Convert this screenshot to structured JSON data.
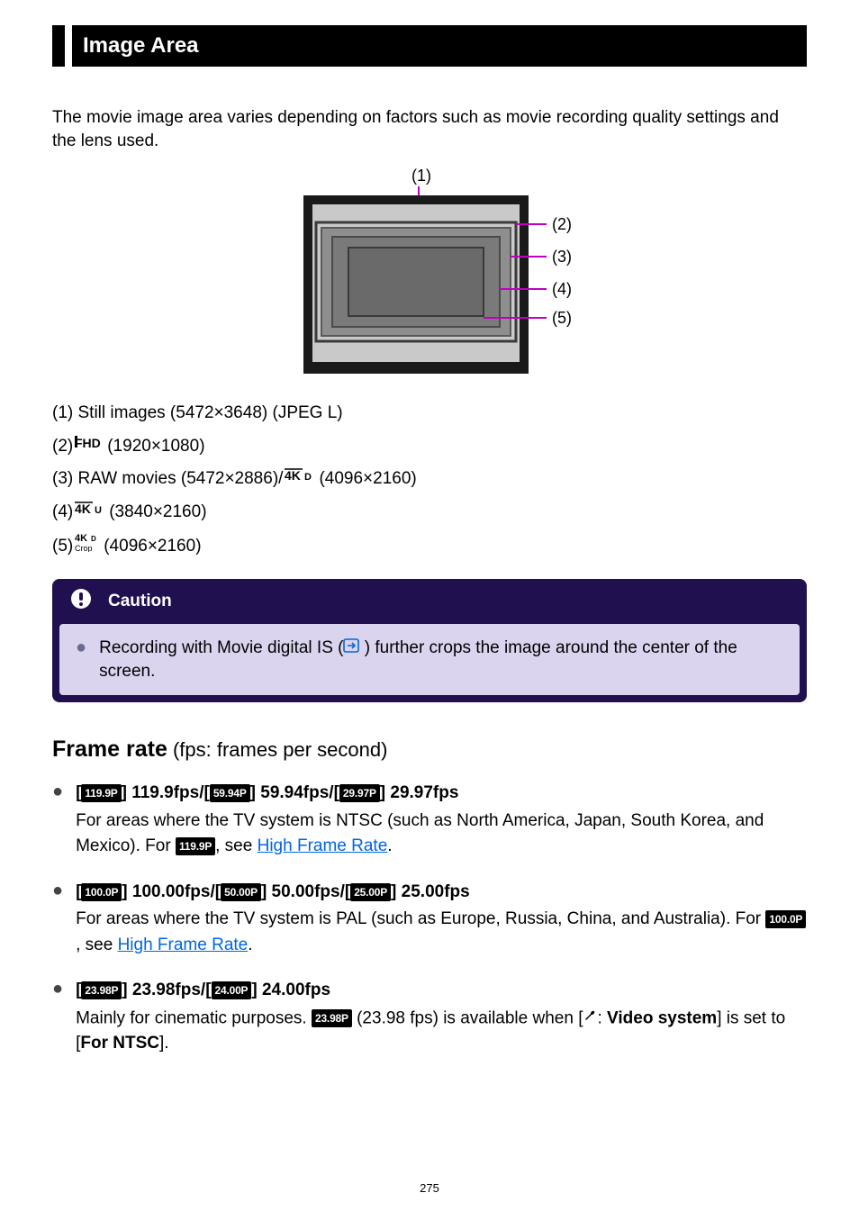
{
  "heading": "Image Area",
  "intro": "The movie image area varies depending on factors such as movie recording quality settings and the lens used.",
  "diagram": {
    "top_label": "(1)",
    "right_labels": [
      "(2)",
      "(3)",
      "(4)",
      "(5)"
    ]
  },
  "resolutions": {
    "r1_pre": "(1) Still images (5472×3648) (JPEG L)",
    "r2_pre": "(2) ",
    "r2_post": " (1920×1080)",
    "r3_pre": "(3) RAW movies (5472×2886)/",
    "r3_post": " (4096×2160)",
    "r4_pre": "(4) ",
    "r4_post": " (3840×2160)",
    "r5_pre": "(5) ",
    "r5_post": " (4096×2160)"
  },
  "caution": {
    "title": "Caution",
    "text_pre": "Recording with Movie digital IS (",
    "text_post": " ) further crops the image around the center of the screen."
  },
  "frame_rate": {
    "title": "Frame rate",
    "subtitle": " (fps: frames per second)",
    "items": [
      {
        "line1_parts": [
          "[",
          "] 119.9fps/[",
          "] 59.94fps/[",
          "] 29.97fps"
        ],
        "badges1": [
          "119.9P",
          "59.94P",
          "29.97P"
        ],
        "body_pre": "For areas where the TV system is NTSC (such as North America, Japan, South Korea, and Mexico). For ",
        "body_badge": "119.9P",
        "body_mid": ", see ",
        "link": "High Frame Rate",
        "body_post": "."
      },
      {
        "line1_parts": [
          "[",
          "] 100.00fps/[",
          "] 50.00fps/[",
          "] 25.00fps"
        ],
        "badges1": [
          "100.0P",
          "50.00P",
          "25.00P"
        ],
        "body_pre": "For areas where the TV system is PAL (such as Europe, Russia, China, and Australia). For ",
        "body_badge": "100.0P",
        "body_mid": ", see ",
        "link": "High Frame Rate",
        "body_post": "."
      },
      {
        "line1_parts": [
          "[",
          "] 23.98fps/[",
          "] 24.00fps"
        ],
        "badges1": [
          "23.98P",
          "24.00P"
        ],
        "body_pre": "Mainly for cinematic purposes. ",
        "body_badge": "23.98P",
        "body_mid": " (23.98 fps) is available when [",
        "body_mid2": ": ",
        "body_bold": "Video system",
        "body_post": "] is set to [",
        "body_bold2": "For NTSC",
        "body_post2": "]."
      }
    ]
  },
  "page_number": "275"
}
